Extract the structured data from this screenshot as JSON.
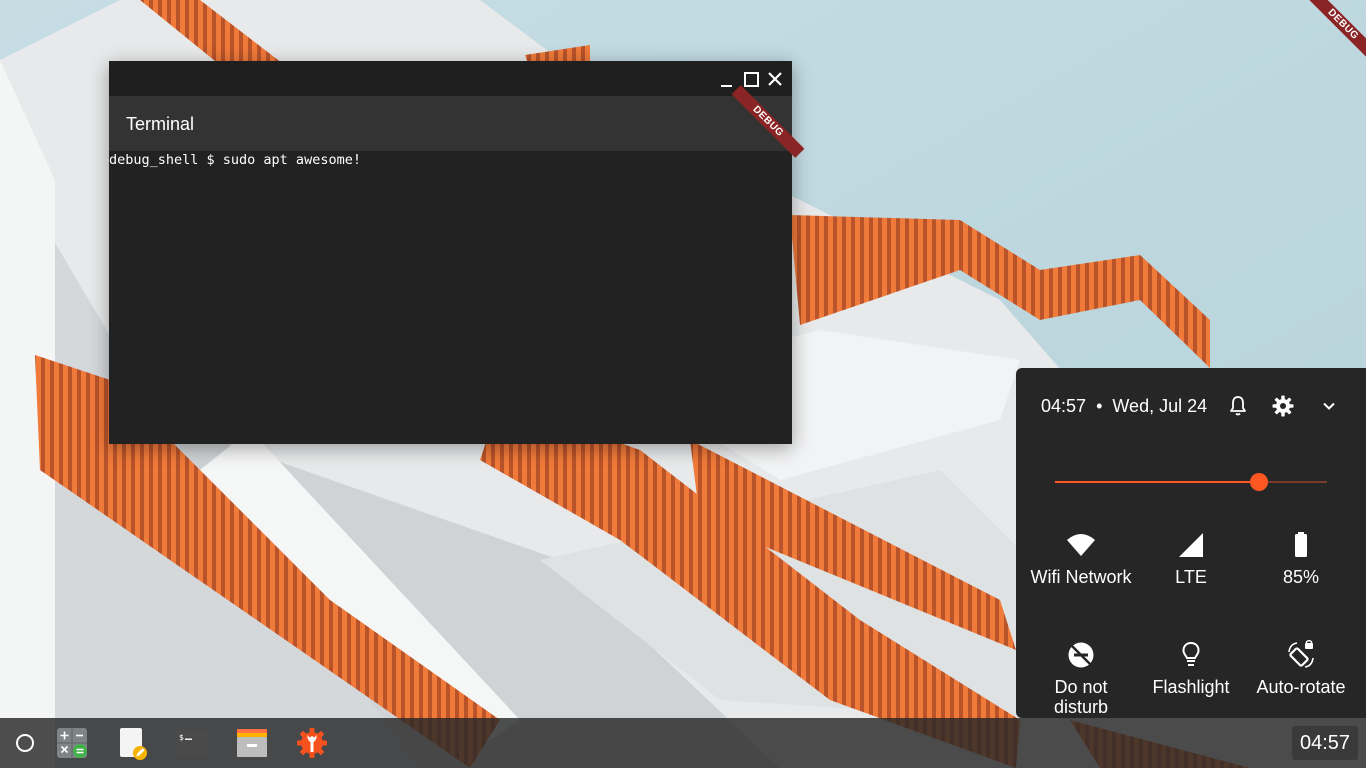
{
  "debug_banner": "DEBUG",
  "terminal": {
    "title": "Terminal",
    "prompt_line": "debug_shell $ sudo apt awesome!",
    "debug_banner": "DEBUG"
  },
  "quick_settings": {
    "time": "04:57",
    "separator": "•",
    "date": "Wed, Jul 24",
    "brightness_level": 0.75,
    "accent_color": "#ff5722",
    "tiles": [
      {
        "label": "Wifi Network",
        "icon": "wifi-icon"
      },
      {
        "label": "LTE",
        "icon": "cellular-signal-icon"
      },
      {
        "label": "85%",
        "icon": "battery-icon"
      },
      {
        "label": "Do not disturb",
        "icon": "do-not-disturb-icon"
      },
      {
        "label": "Flashlight",
        "icon": "flashlight-icon"
      },
      {
        "label": "Auto-rotate",
        "icon": "auto-rotate-icon"
      }
    ]
  },
  "taskbar": {
    "clock": "04:57",
    "apps": [
      "calculator-icon",
      "text-editor-icon",
      "terminal-icon",
      "file-manager-icon",
      "settings-icon"
    ]
  }
}
